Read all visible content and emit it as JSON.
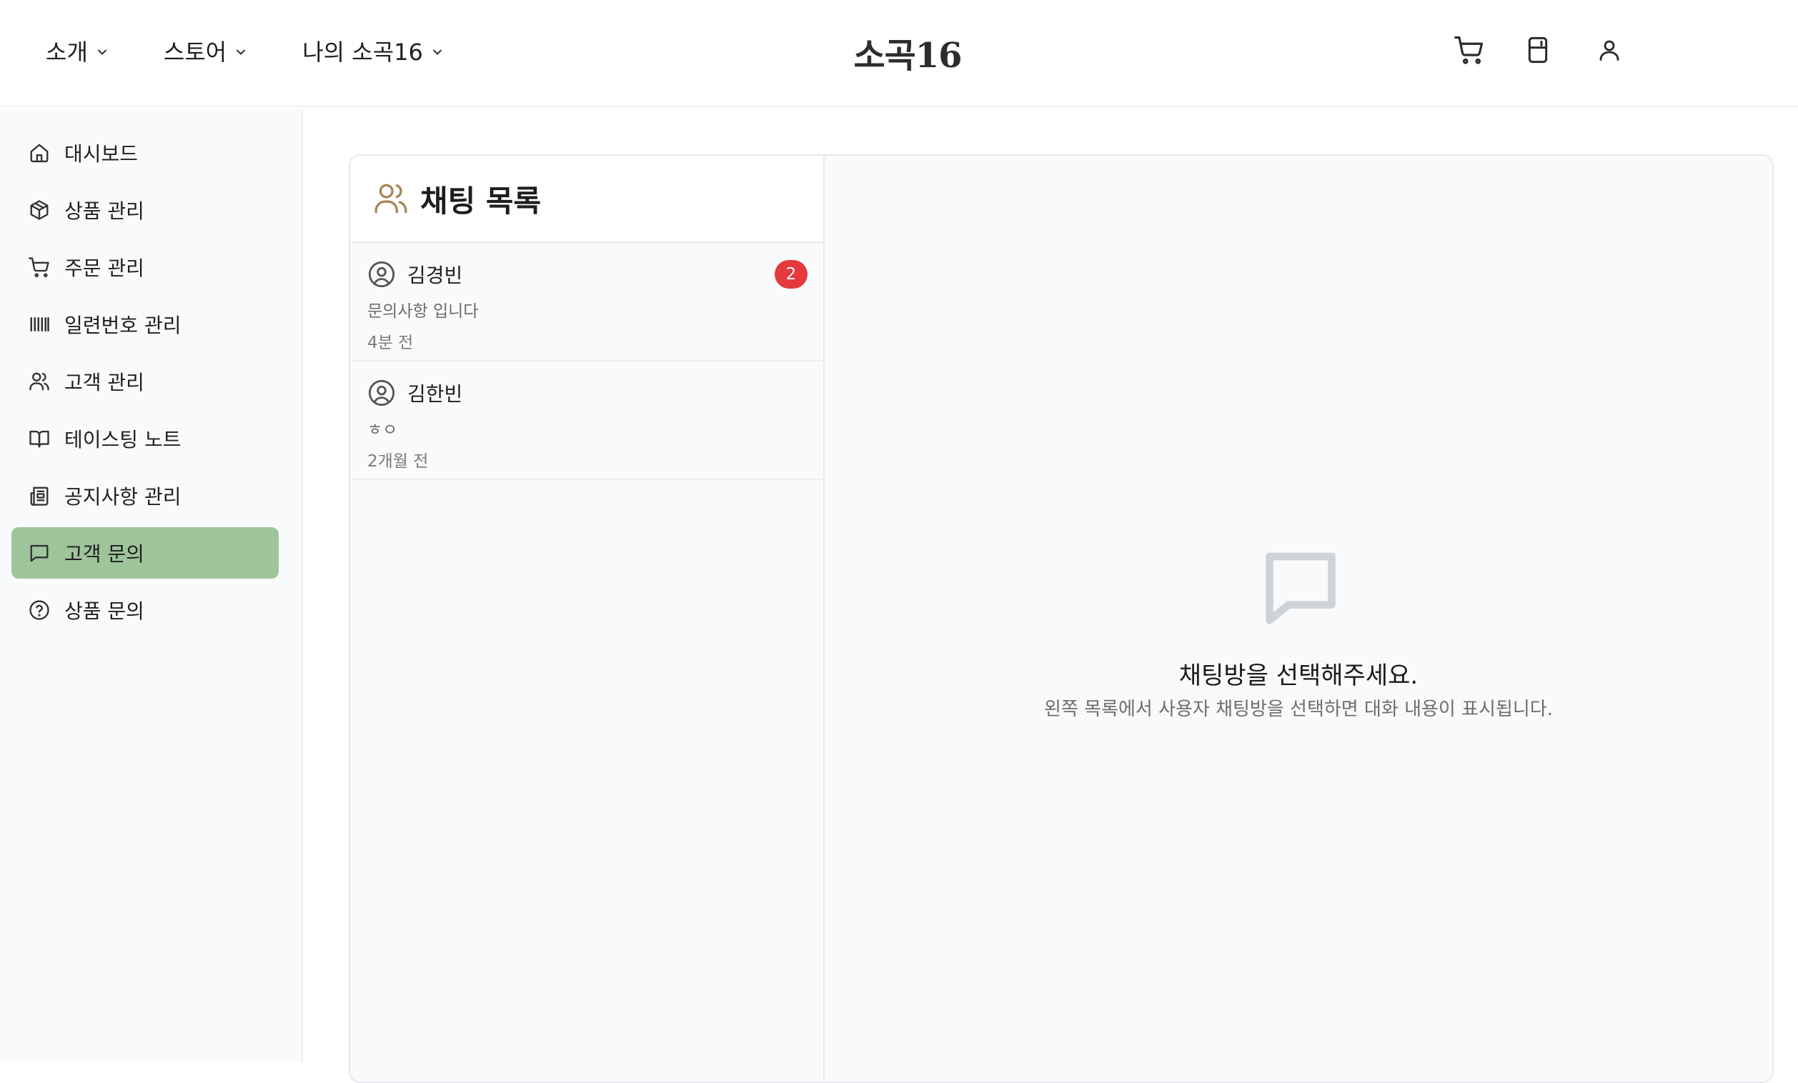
{
  "header": {
    "brand": "소곡16",
    "nav": [
      {
        "label": "소개",
        "icon": "chevron-down-icon"
      },
      {
        "label": "스토어",
        "icon": "chevron-down-icon"
      },
      {
        "label": "나의 소곡16",
        "icon": "chevron-down-icon"
      }
    ],
    "icons": [
      "cart-icon",
      "fridge-icon",
      "user-icon"
    ]
  },
  "sidebar": {
    "items": [
      {
        "label": "대시보드",
        "icon": "home-icon",
        "active": false
      },
      {
        "label": "상품 관리",
        "icon": "package-icon",
        "active": false
      },
      {
        "label": "주문 관리",
        "icon": "cart-icon",
        "active": false
      },
      {
        "label": "일련번호 관리",
        "icon": "barcode-icon",
        "active": false
      },
      {
        "label": "고객 관리",
        "icon": "users-icon",
        "active": false
      },
      {
        "label": "테이스팅 노트",
        "icon": "book-icon",
        "active": false
      },
      {
        "label": "공지사항 관리",
        "icon": "newspaper-icon",
        "active": false
      },
      {
        "label": "고객 문의",
        "icon": "message-icon",
        "active": true
      },
      {
        "label": "상품 문의",
        "icon": "help-circle-icon",
        "active": false
      }
    ],
    "active_color": "#9ec49a"
  },
  "chat_list": {
    "title": "채팅 목록",
    "icon": "users-icon",
    "items": [
      {
        "name": "김경빈",
        "message": "문의사항 입니다",
        "time": "4분 전",
        "unread": "2"
      },
      {
        "name": "김한빈",
        "message": "ㅎㅇ",
        "time": "2개월 전",
        "unread": ""
      }
    ]
  },
  "empty_state": {
    "icon": "message-square-icon",
    "title": "채팅방을 선택해주세요.",
    "subtitle": "왼쪽 목록에서 사용자 채팅방을 선택하면 대화 내용이 표시됩니다."
  },
  "colors": {
    "badge": "#e5393e",
    "title_icon": "#a8865a"
  }
}
